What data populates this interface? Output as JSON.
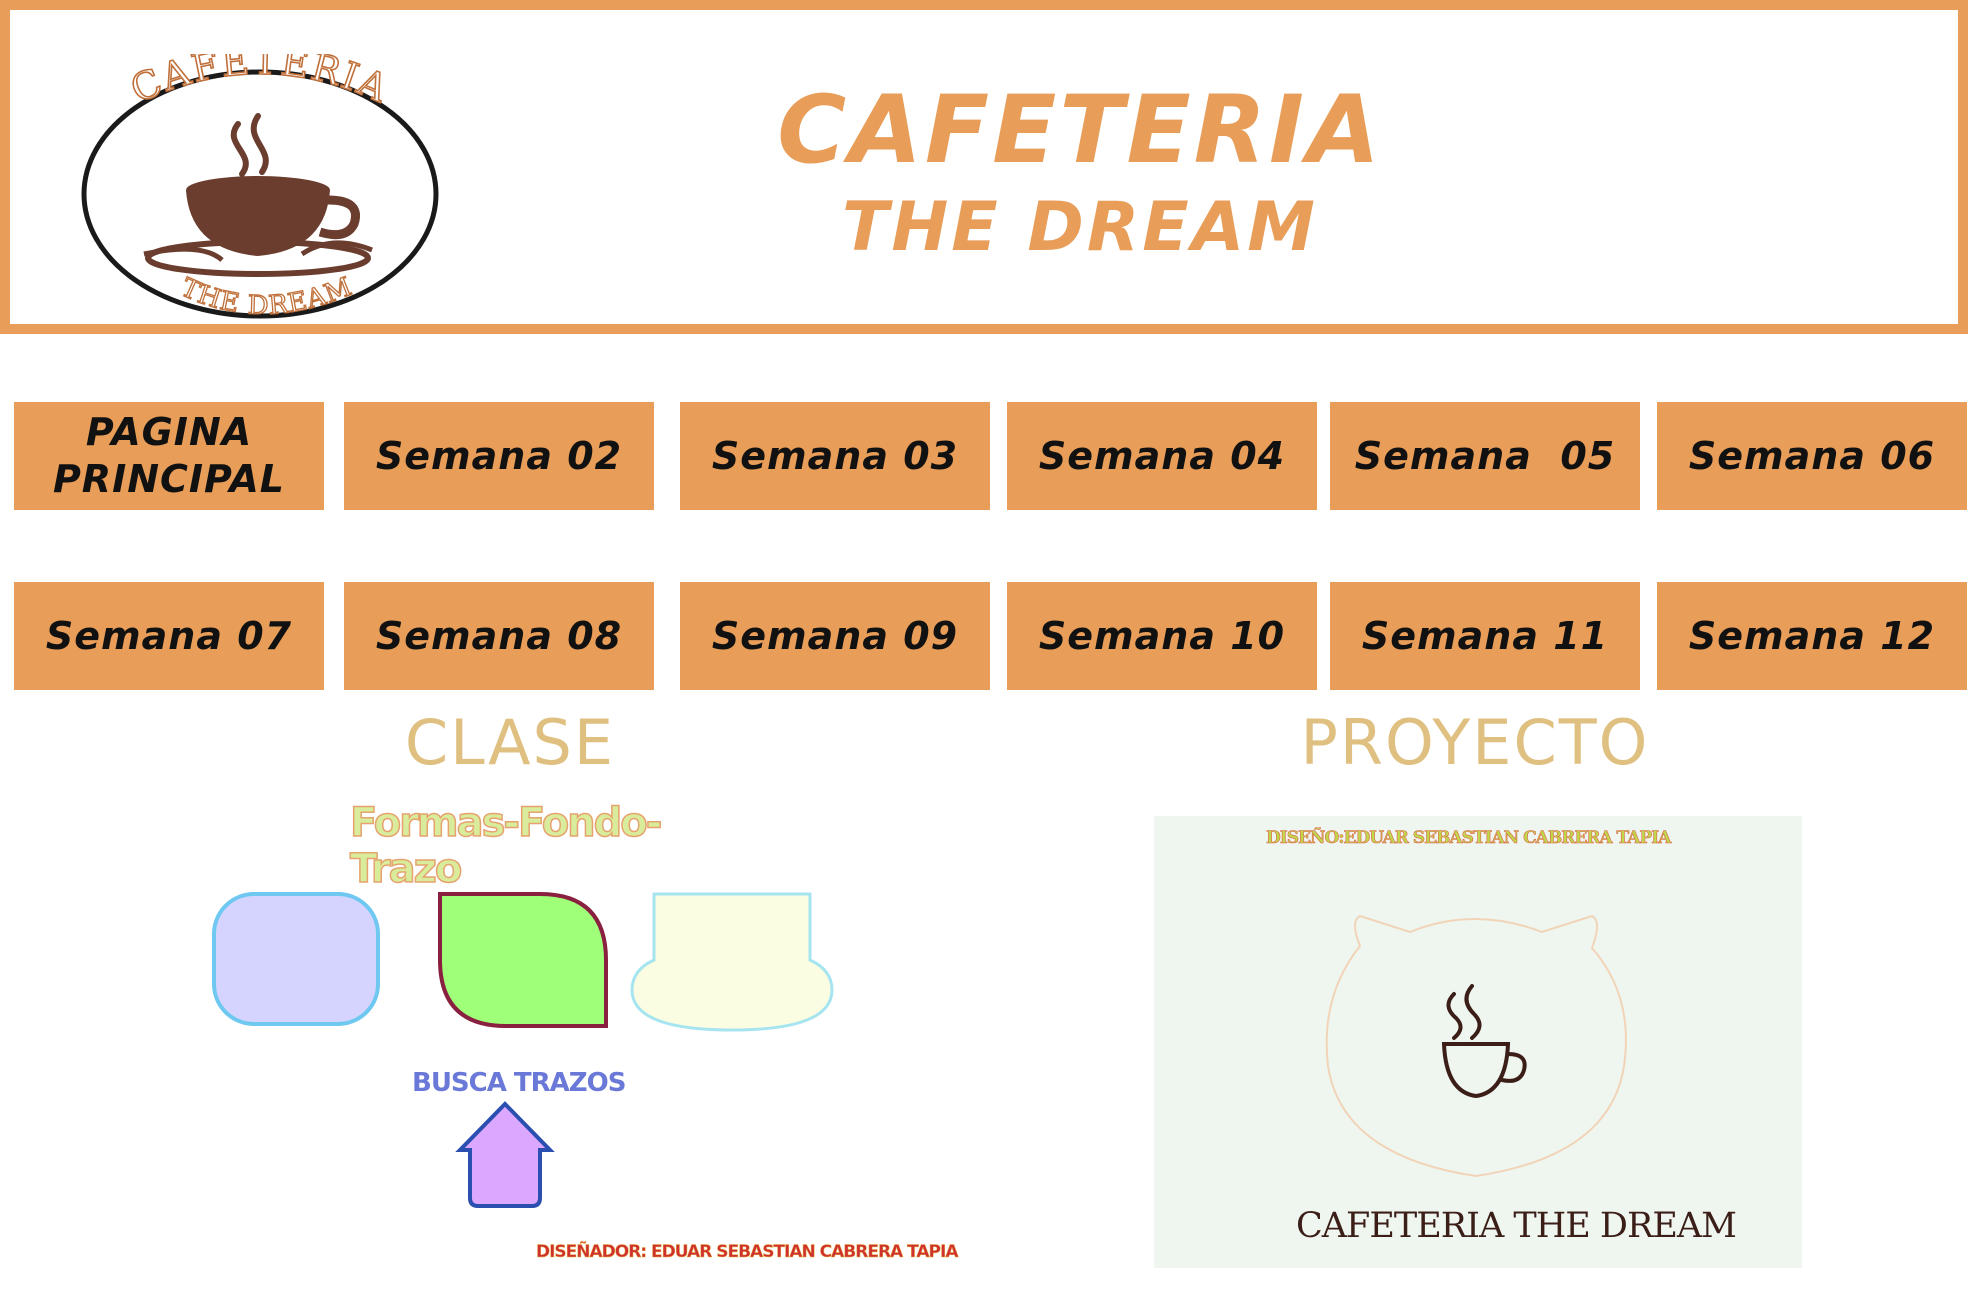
{
  "header": {
    "logo": {
      "top_text": "CAFETERIA",
      "bottom_text": "THE DREAM"
    },
    "title": "CAFETERIA",
    "subtitle": "THE DREAM",
    "accent_color": "#e89d58"
  },
  "nav": {
    "row1": [
      {
        "label": "PAGINA PRINCIPAL"
      },
      {
        "label": "Semana 02"
      },
      {
        "label": "Semana 03"
      },
      {
        "label": "Semana 04"
      },
      {
        "label": "Semana  05"
      },
      {
        "label": "Semana 06"
      }
    ],
    "row2": [
      {
        "label": "Semana 07"
      },
      {
        "label": "Semana 08"
      },
      {
        "label": "Semana 09"
      },
      {
        "label": "Semana 10"
      },
      {
        "label": "Semana 11"
      },
      {
        "label": "Semana 12"
      }
    ]
  },
  "clase": {
    "heading": "CLASE",
    "subtitle": "Formas-Fondo-Trazo",
    "caption": "BUSCA TRAZOS",
    "designer": "DISEÑADOR: EDUAR SEBASTIAN CABRERA TAPIA"
  },
  "proyecto": {
    "heading": "PROYECTO",
    "designer": "DISEÑO:EDUAR SEBASTIAN CABRERA TAPIA",
    "brand": "CAFETERIA THE DREAM"
  }
}
